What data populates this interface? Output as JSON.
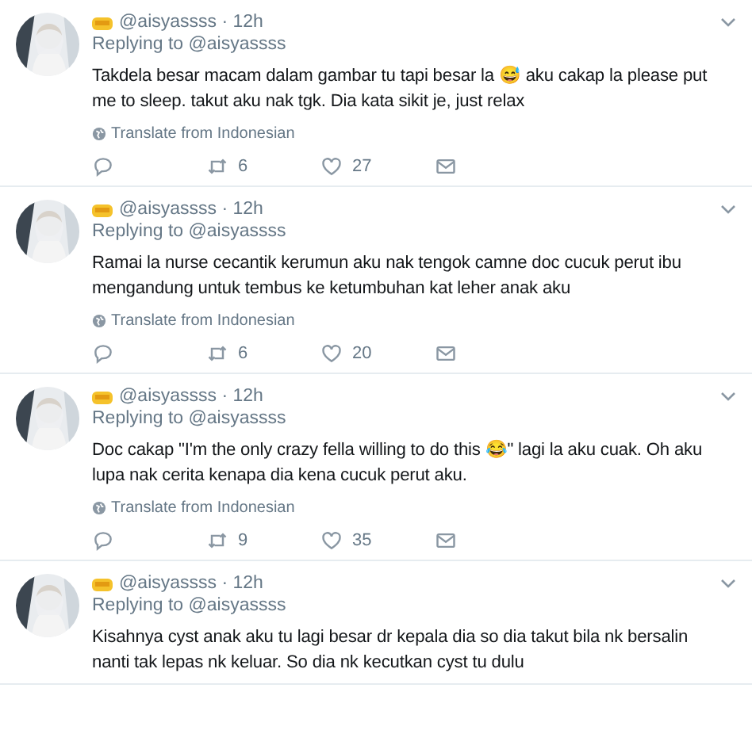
{
  "tweets": [
    {
      "handle": "@aisyassss · 12h",
      "reply_to": "Replying to @aisyassss",
      "text": "Takdela besar macam dalam gambar tu tapi besar la 😅 aku cakap la please put me to sleep. takut aku nak tgk. Dia kata sikit je,  just relax",
      "translate": "Translate from Indonesian",
      "retweets": "6",
      "likes": "27"
    },
    {
      "handle": "@aisyassss · 12h",
      "reply_to": "Replying to @aisyassss",
      "text": "Ramai la nurse cecantik kerumun aku nak tengok camne doc cucuk perut ibu mengandung untuk tembus ke ketumbuhan kat leher anak aku",
      "translate": "Translate from Indonesian",
      "retweets": "6",
      "likes": "20"
    },
    {
      "handle": "@aisyassss · 12h",
      "reply_to": "Replying to @aisyassss",
      "text": "Doc cakap \"I'm the only crazy fella willing to do this 😂\" lagi la aku cuak. Oh aku lupa nak cerita kenapa dia kena cucuk perut aku.",
      "translate": "Translate from Indonesian",
      "retweets": "9",
      "likes": "35"
    },
    {
      "handle": "@aisyassss · 12h",
      "reply_to": "Replying to @aisyassss",
      "text": "Kisahnya cyst anak aku tu lagi besar dr kepala dia so dia takut bila nk bersalin nanti tak lepas nk keluar. So dia nk kecutkan cyst tu dulu"
    }
  ]
}
